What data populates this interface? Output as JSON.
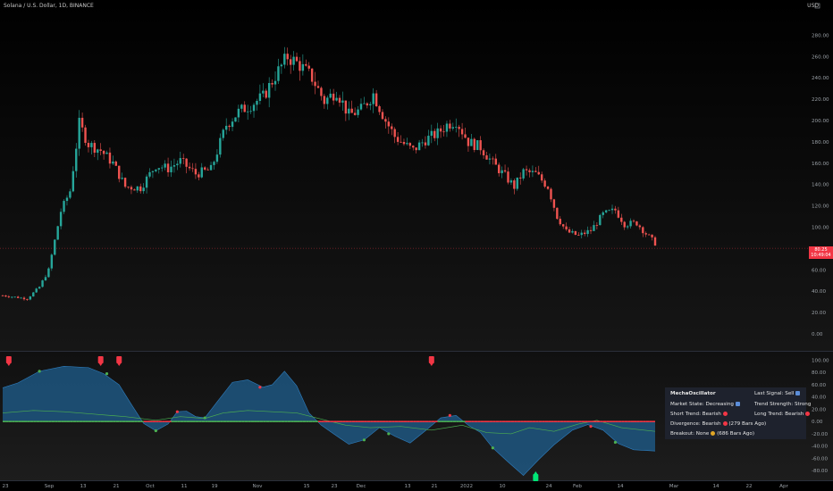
{
  "header": {
    "symbol": "Solana / U.S. Dollar, 1D, BINANCE",
    "currency": "USD"
  },
  "price_tag": {
    "price": "80.25",
    "countdown": "10:49:04"
  },
  "colors": {
    "up": "#26a69a",
    "down": "#ef5350",
    "bg": "#000000",
    "osc_fill": "#1f5f8f",
    "signal_line": "#4caf50",
    "zero_bull": "#4caf50",
    "zero_bear": "#f23645"
  },
  "table": {
    "title": "MechaOscillator",
    "last_signal": "Last Signal: Sell",
    "market_state": "Market State: Decreasing",
    "trend_strength": "Trend Strength: Strong",
    "short_trend": "Short Trend: Bearish",
    "long_trend": "Long Trend: Bearish",
    "divergence": "Divergence: Bearish",
    "divergence_ago": "(279 Bars Ago)",
    "breakout": "Breakout: None",
    "breakout_ago": "(686 Bars Ago)"
  },
  "chart_data": [
    {
      "type": "candlestick",
      "title": "Solana / U.S. Dollar, 1D, BINANCE",
      "ylabel": "USD",
      "y_ticks": [
        "280.00",
        "260.00",
        "240.00",
        "220.00",
        "200.00",
        "180.00",
        "160.00",
        "140.00",
        "120.00",
        "100.00",
        "60.00",
        "40.00",
        "20.00",
        "0.00"
      ],
      "ylim": [
        -5,
        287
      ],
      "x_ticks": [
        "23",
        "Sep",
        "13",
        "21",
        "Oct",
        "11",
        "19",
        "Nov",
        "15",
        "23",
        "Dec",
        "13",
        "21",
        "2022",
        "10",
        "24",
        "Feb",
        "14",
        "Mar",
        "14",
        "22",
        "Apr"
      ],
      "close_path": [
        {
          "t": 0,
          "v": 36
        },
        {
          "t": 8,
          "v": 33
        },
        {
          "t": 12,
          "v": 44
        },
        {
          "t": 15,
          "v": 60
        },
        {
          "t": 19,
          "v": 115
        },
        {
          "t": 22,
          "v": 134
        },
        {
          "t": 25,
          "v": 197
        },
        {
          "t": 28,
          "v": 178
        },
        {
          "t": 32,
          "v": 172
        },
        {
          "t": 36,
          "v": 160
        },
        {
          "t": 40,
          "v": 138
        },
        {
          "t": 45,
          "v": 137
        },
        {
          "t": 50,
          "v": 158
        },
        {
          "t": 54,
          "v": 155
        },
        {
          "t": 58,
          "v": 162
        },
        {
          "t": 63,
          "v": 150
        },
        {
          "t": 68,
          "v": 154
        },
        {
          "t": 73,
          "v": 196
        },
        {
          "t": 77,
          "v": 208
        },
        {
          "t": 81,
          "v": 215
        },
        {
          "t": 85,
          "v": 222
        },
        {
          "t": 89,
          "v": 242
        },
        {
          "t": 93,
          "v": 260
        },
        {
          "t": 97,
          "v": 252
        },
        {
          "t": 101,
          "v": 240
        },
        {
          "t": 105,
          "v": 218
        },
        {
          "t": 109,
          "v": 228
        },
        {
          "t": 113,
          "v": 205
        },
        {
          "t": 117,
          "v": 210
        },
        {
          "t": 121,
          "v": 225
        },
        {
          "t": 125,
          "v": 200
        },
        {
          "t": 128,
          "v": 185
        },
        {
          "t": 131,
          "v": 178
        },
        {
          "t": 134,
          "v": 172
        },
        {
          "t": 138,
          "v": 182
        },
        {
          "t": 142,
          "v": 188
        },
        {
          "t": 145,
          "v": 196
        },
        {
          "t": 148,
          "v": 200
        },
        {
          "t": 152,
          "v": 180
        },
        {
          "t": 156,
          "v": 175
        },
        {
          "t": 160,
          "v": 160
        },
        {
          "t": 164,
          "v": 148
        },
        {
          "t": 167,
          "v": 138
        },
        {
          "t": 170,
          "v": 152
        },
        {
          "t": 174,
          "v": 150
        },
        {
          "t": 178,
          "v": 138
        },
        {
          "t": 181,
          "v": 110
        },
        {
          "t": 184,
          "v": 96
        },
        {
          "t": 188,
          "v": 92
        },
        {
          "t": 192,
          "v": 97
        },
        {
          "t": 196,
          "v": 112
        },
        {
          "t": 200,
          "v": 116
        },
        {
          "t": 203,
          "v": 103
        },
        {
          "t": 207,
          "v": 104
        },
        {
          "t": 210,
          "v": 94
        },
        {
          "t": 213,
          "v": 85
        }
      ],
      "last_price": 80.25
    },
    {
      "type": "oscillator",
      "title": "MechaOscillator",
      "y_ticks": [
        "100.00",
        "80.00",
        "60.00",
        "40.00",
        "20.00",
        "0.00",
        "-20.00",
        "-40.00",
        "-60.00",
        "-80.00"
      ],
      "ylim": [
        -90,
        108
      ],
      "oscillator": [
        {
          "t": 0,
          "v": 55
        },
        {
          "t": 5,
          "v": 63
        },
        {
          "t": 12,
          "v": 82
        },
        {
          "t": 20,
          "v": 90
        },
        {
          "t": 28,
          "v": 88
        },
        {
          "t": 33,
          "v": 78
        },
        {
          "t": 38,
          "v": 60
        },
        {
          "t": 42,
          "v": 28
        },
        {
          "t": 46,
          "v": -3
        },
        {
          "t": 50,
          "v": -15
        },
        {
          "t": 54,
          "v": -4
        },
        {
          "t": 57,
          "v": 16
        },
        {
          "t": 60,
          "v": 17
        },
        {
          "t": 63,
          "v": 8
        },
        {
          "t": 66,
          "v": 6
        },
        {
          "t": 70,
          "v": 32
        },
        {
          "t": 75,
          "v": 64
        },
        {
          "t": 80,
          "v": 68
        },
        {
          "t": 85,
          "v": 56
        },
        {
          "t": 88,
          "v": 60
        },
        {
          "t": 92,
          "v": 82
        },
        {
          "t": 96,
          "v": 58
        },
        {
          "t": 100,
          "v": 14
        },
        {
          "t": 104,
          "v": -6
        },
        {
          "t": 108,
          "v": -20
        },
        {
          "t": 113,
          "v": -37
        },
        {
          "t": 118,
          "v": -30
        },
        {
          "t": 123,
          "v": -10
        },
        {
          "t": 128,
          "v": -24
        },
        {
          "t": 133,
          "v": -35
        },
        {
          "t": 138,
          "v": -15
        },
        {
          "t": 143,
          "v": 6
        },
        {
          "t": 148,
          "v": 10
        },
        {
          "t": 152,
          "v": -6
        },
        {
          "t": 156,
          "v": -18
        },
        {
          "t": 160,
          "v": -43
        },
        {
          "t": 165,
          "v": -66
        },
        {
          "t": 170,
          "v": -88
        },
        {
          "t": 175,
          "v": -62
        },
        {
          "t": 180,
          "v": -38
        },
        {
          "t": 186,
          "v": -14
        },
        {
          "t": 191,
          "v": -5
        },
        {
          "t": 196,
          "v": -14
        },
        {
          "t": 201,
          "v": -36
        },
        {
          "t": 206,
          "v": -46
        },
        {
          "t": 213,
          "v": -48
        }
      ],
      "signal_line": [
        {
          "t": 0,
          "v": 14
        },
        {
          "t": 10,
          "v": 18
        },
        {
          "t": 20,
          "v": 16
        },
        {
          "t": 30,
          "v": 12
        },
        {
          "t": 40,
          "v": 8
        },
        {
          "t": 50,
          "v": 2
        },
        {
          "t": 58,
          "v": 8
        },
        {
          "t": 66,
          "v": 5
        },
        {
          "t": 72,
          "v": 14
        },
        {
          "t": 80,
          "v": 18
        },
        {
          "t": 88,
          "v": 16
        },
        {
          "t": 96,
          "v": 14
        },
        {
          "t": 104,
          "v": 4
        },
        {
          "t": 112,
          "v": -6
        },
        {
          "t": 120,
          "v": -10
        },
        {
          "t": 130,
          "v": -8
        },
        {
          "t": 140,
          "v": -14
        },
        {
          "t": 150,
          "v": -6
        },
        {
          "t": 158,
          "v": -18
        },
        {
          "t": 166,
          "v": -20
        },
        {
          "t": 172,
          "v": -10
        },
        {
          "t": 180,
          "v": -16
        },
        {
          "t": 188,
          "v": -4
        },
        {
          "t": 194,
          "v": 2
        },
        {
          "t": 202,
          "v": -10
        },
        {
          "t": 213,
          "v": -16
        }
      ],
      "sell_signals_t": [
        2,
        32,
        38,
        140
      ],
      "buy_signals_t": [
        174
      ],
      "pivot_dots": [
        {
          "t": 12,
          "v": 82,
          "c": "#4caf50"
        },
        {
          "t": 34,
          "v": 78,
          "c": "#4caf50"
        },
        {
          "t": 50,
          "v": -15,
          "c": "#4caf50"
        },
        {
          "t": 57,
          "v": 16,
          "c": "#f23645"
        },
        {
          "t": 66,
          "v": 6,
          "c": "#4caf50"
        },
        {
          "t": 84,
          "v": 56,
          "c": "#f23645"
        },
        {
          "t": 118,
          "v": -30,
          "c": "#4caf50"
        },
        {
          "t": 126,
          "v": -20,
          "c": "#4caf50"
        },
        {
          "t": 146,
          "v": 10,
          "c": "#f23645"
        },
        {
          "t": 160,
          "v": -43,
          "c": "#4caf50"
        },
        {
          "t": 192,
          "v": -8,
          "c": "#f23645"
        },
        {
          "t": 200,
          "v": -34,
          "c": "#4caf50"
        }
      ]
    }
  ]
}
